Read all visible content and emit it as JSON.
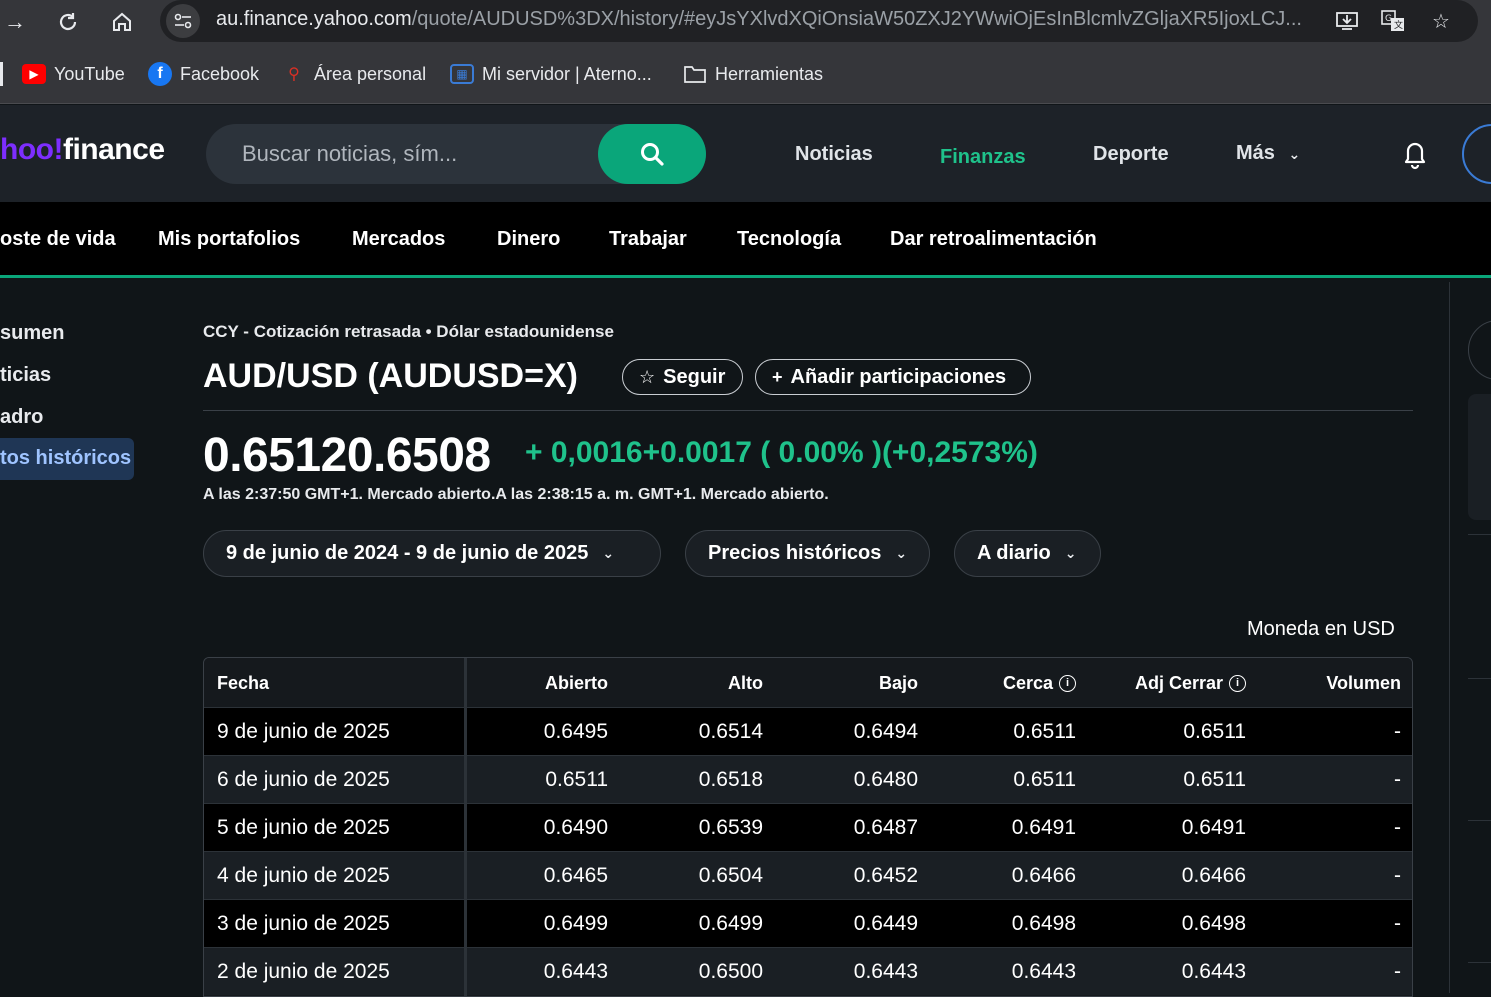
{
  "browser": {
    "url_host": "au.finance.yahoo.com",
    "url_path": "/quote/AUDUSD%3DX/history/#eyJsYXlvdXQiOnsiaW50ZXJ2YWwiOjEsInBlcmlvZGljaXR5IjoxLCJ...",
    "bookmarks": [
      {
        "label": "YouTube",
        "icon": "youtube-icon"
      },
      {
        "label": "Facebook",
        "icon": "facebook-icon"
      },
      {
        "label": "Área personal",
        "icon": "area-icon"
      },
      {
        "label": "Mi servidor | Aterno...",
        "icon": "aternos-icon"
      },
      {
        "label": "Herramientas",
        "icon": "folder-icon"
      }
    ]
  },
  "header": {
    "logo_y": "hoo!",
    "logo_rest": "finance",
    "search_placeholder": "Buscar noticias, sím...",
    "nav": [
      "Noticias",
      "Finanzas",
      "Deporte",
      "Más"
    ]
  },
  "subnav": [
    "oste de vida",
    "Mis portafolios",
    "Mercados",
    "Dinero",
    "Trabajar",
    "Tecnología",
    "Dar retroalimentación"
  ],
  "leftnav": [
    "sumen",
    "ticias",
    "adro",
    "tos históricos"
  ],
  "quote": {
    "exchange": "CCY - Cotización retrasada • Dólar estadounidense",
    "title": "AUD/USD (AUDUSD=X)",
    "follow": "Seguir",
    "add_holdings": "Añadir participaciones",
    "price": "0.65120.6508",
    "change": "+ 0,0016+0.0017  ( 0.00% )(+0,2573%)",
    "market_status": "A las 2:37:50 GMT+1. Mercado abierto.A las 2:38:15 a. m. GMT+1. Mercado abierto.",
    "filters": {
      "range": "9 de junio de 2024 - 9 de junio de 2025",
      "type": "Precios históricos",
      "freq": "A diario"
    },
    "currency_note": "Moneda en USD"
  },
  "table": {
    "headers": [
      "Fecha",
      "Abierto",
      "Alto",
      "Bajo",
      "Cerca",
      "Adj Cerrar",
      "Volumen"
    ],
    "rows": [
      [
        "9 de junio de 2025",
        "0.6495",
        "0.6514",
        "0.6494",
        "0.6511",
        "0.6511",
        "-"
      ],
      [
        "6 de junio de 2025",
        "0.6511",
        "0.6518",
        "0.6480",
        "0.6511",
        "0.6511",
        "-"
      ],
      [
        "5 de junio de 2025",
        "0.6490",
        "0.6539",
        "0.6487",
        "0.6491",
        "0.6491",
        "-"
      ],
      [
        "4 de junio de 2025",
        "0.6465",
        "0.6504",
        "0.6452",
        "0.6466",
        "0.6466",
        "-"
      ],
      [
        "3 de junio de 2025",
        "0.6499",
        "0.6499",
        "0.6449",
        "0.6498",
        "0.6498",
        "-"
      ],
      [
        "2 de junio de 2025",
        "0.6443",
        "0.6500",
        "0.6443",
        "0.6443",
        "0.6443",
        "-"
      ]
    ]
  },
  "colors": {
    "accent": "#1fc28b",
    "search_btn": "#0aa67a",
    "logo_purple": "#7d2eff"
  }
}
